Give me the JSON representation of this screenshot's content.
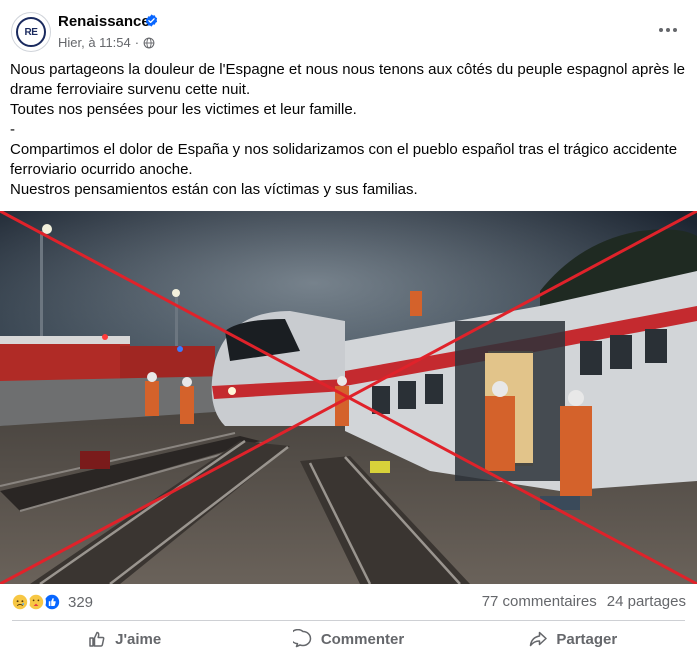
{
  "post": {
    "page_name": "Renaissance",
    "avatar_text": "RE",
    "timestamp": "Hier, à 11:54",
    "meta_separator": "·",
    "text_lines": [
      "Nous partageons la douleur de l'Espagne et nous nous tenons aux côtés du peuple espagnol après le drame ferroviaire survenu cette nuit.",
      "Toutes nos pensées pour les victimes et leur famille.",
      "-",
      "Compartimos el dolor de España y nos solidarizamos con el pueblo español tras el trágico accidente ferroviario ocurrido anoche.",
      "Nuestros pensamientos están con las víctimas y sus familias."
    ]
  },
  "photo": {
    "description_icon": "train-crash-photo",
    "cross_color": "#e0222a"
  },
  "engagement": {
    "reaction_count": "329",
    "comments": "77 commentaires",
    "shares": "24 partages"
  },
  "actions": {
    "like": "J'aime",
    "comment": "Commenter",
    "share": "Partager"
  },
  "colors": {
    "brand_blue": "#0866ff",
    "muted_text": "#65676b",
    "divider": "#ced0d4"
  }
}
